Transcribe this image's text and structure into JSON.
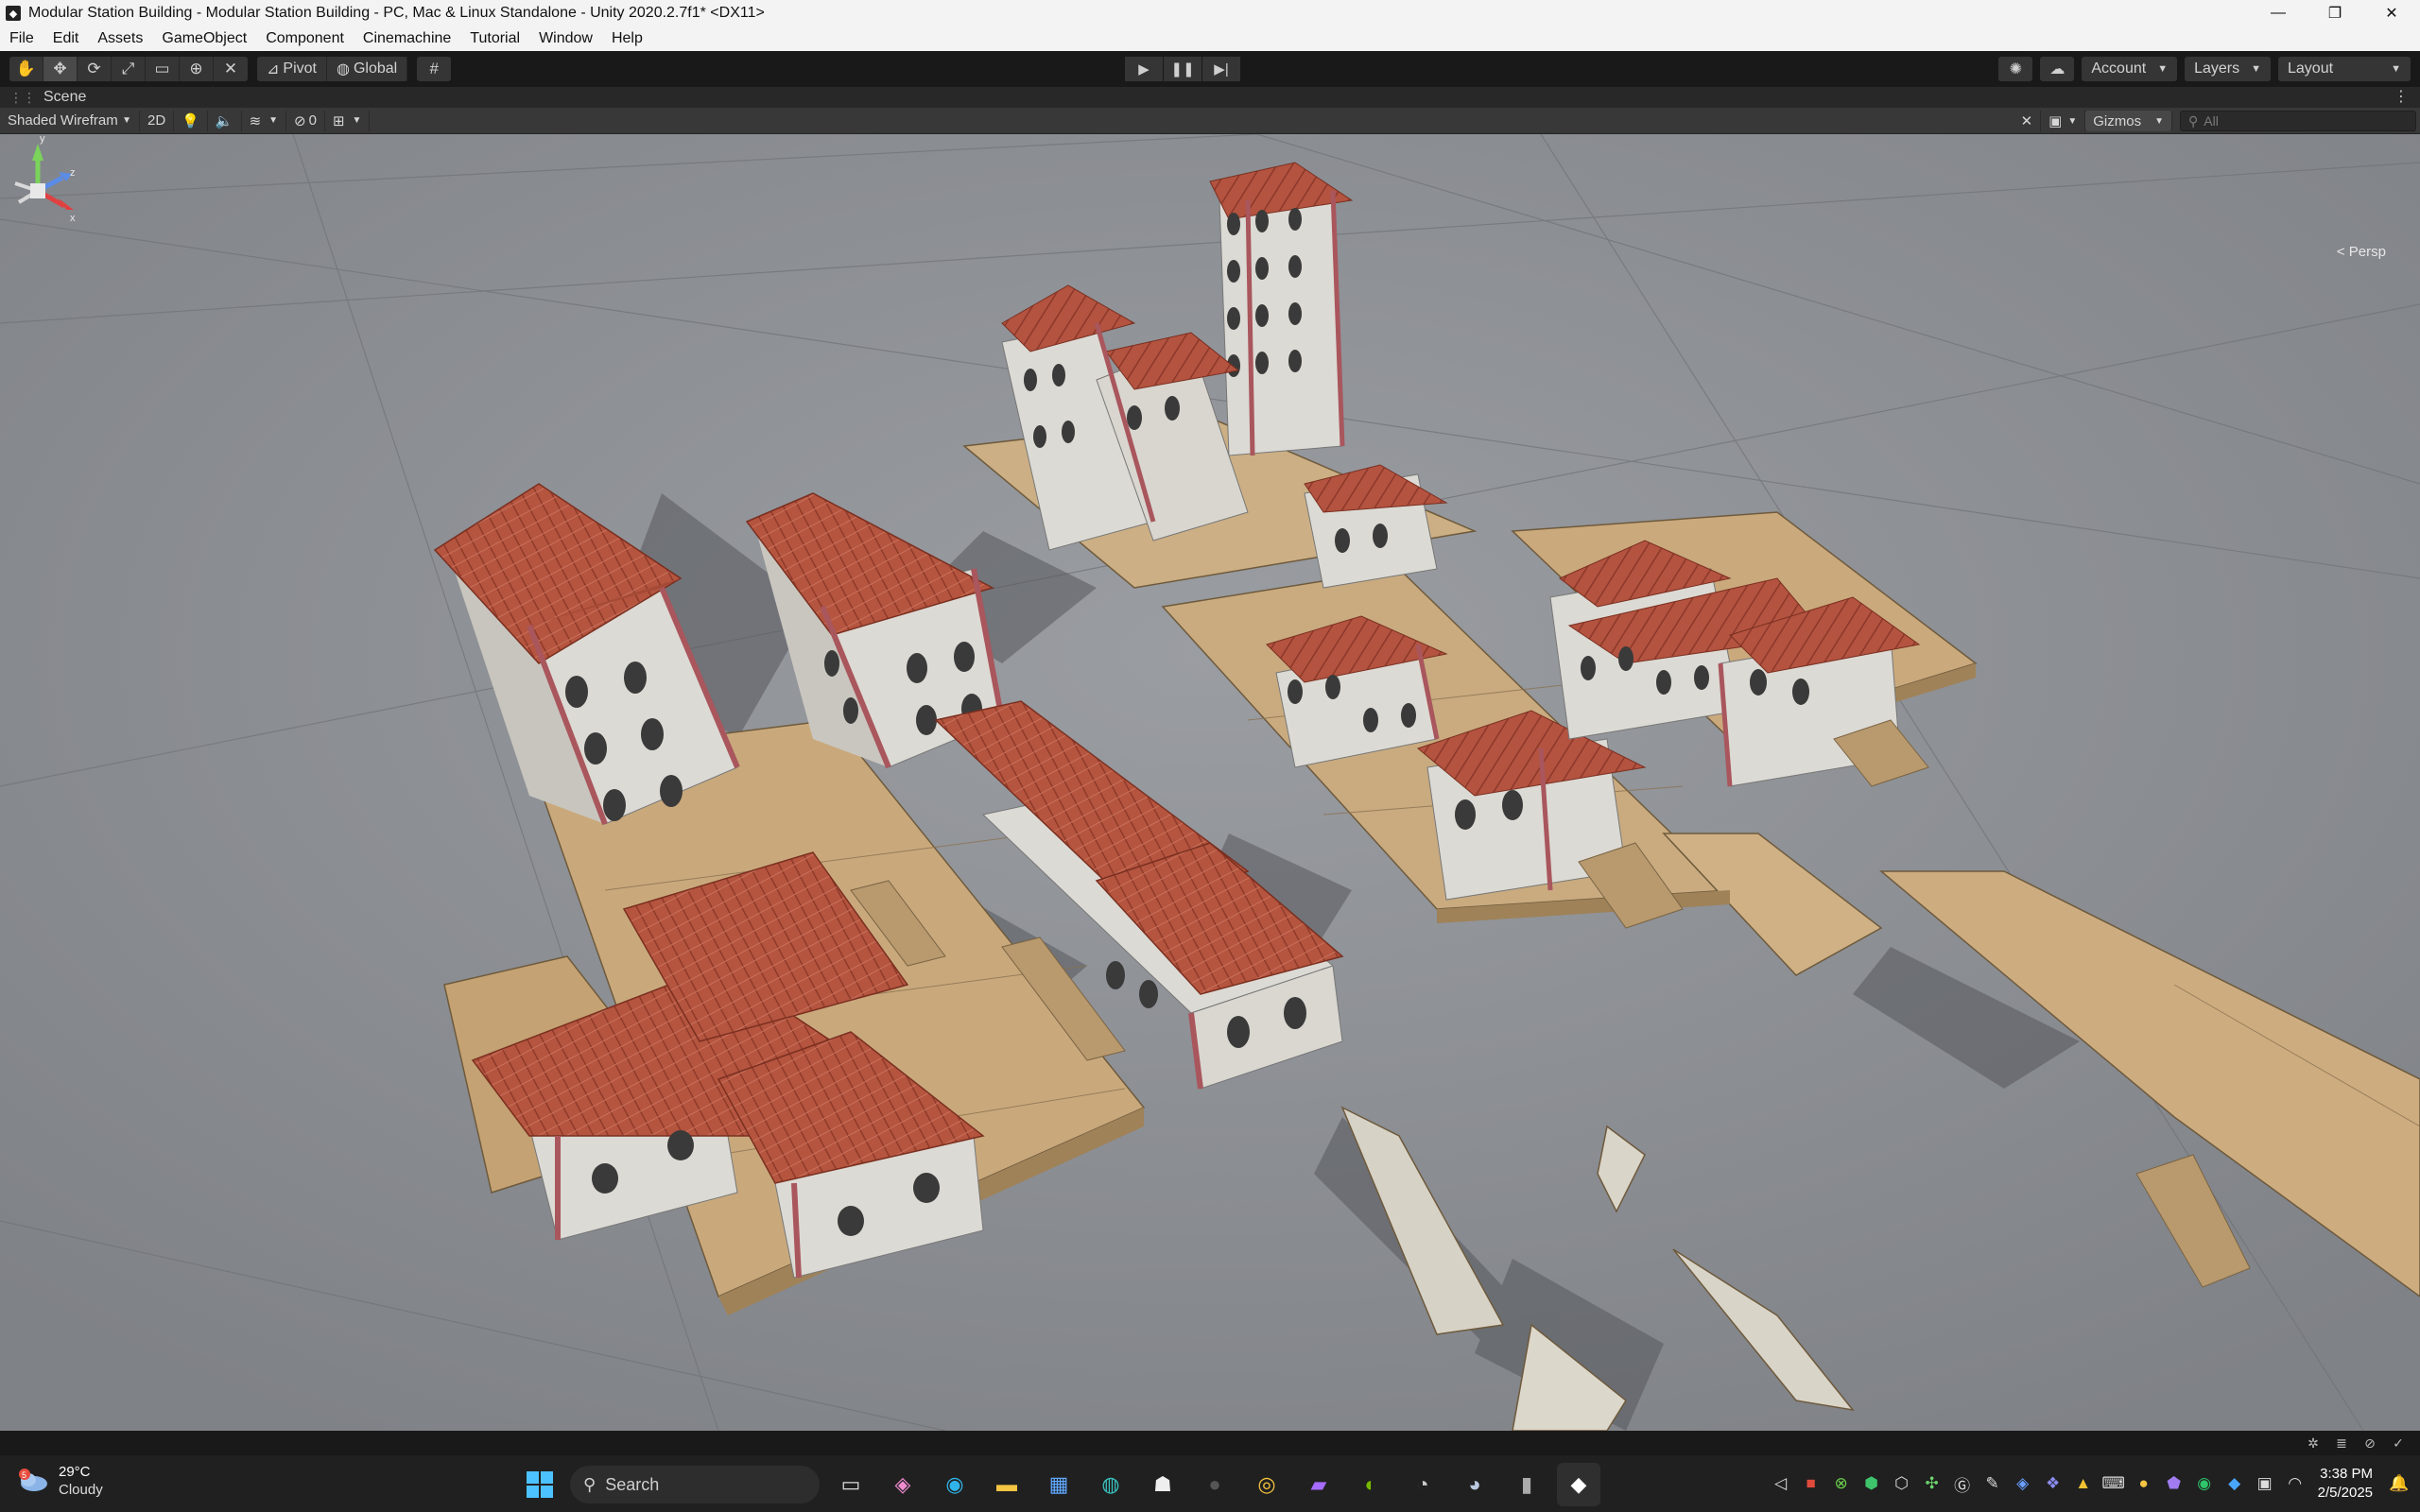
{
  "window": {
    "title": "Modular Station Building - Modular Station Building - PC, Mac & Linux Standalone - Unity 2020.2.7f1* <DX11>",
    "minimize": "—",
    "maximize": "❐",
    "close": "✕"
  },
  "menu": [
    "File",
    "Edit",
    "Assets",
    "GameObject",
    "Component",
    "Cinemachine",
    "Tutorial",
    "Window",
    "Help"
  ],
  "toolbar": {
    "pivot": "Pivot",
    "global": "Global",
    "account": "Account",
    "layers": "Layers",
    "layout": "Layout"
  },
  "scene": {
    "tab_label": "Scene",
    "shading_mode": "Shaded Wirefram",
    "mode_2d": "2D",
    "hidden_count": "0",
    "gizmos": "Gizmos",
    "search_placeholder": "All",
    "projection": "< Persp"
  },
  "taskbar": {
    "weather_temp": "29°C",
    "weather_condition": "Cloudy",
    "weather_badge": "5",
    "search_label": "Search",
    "time": "3:38 PM",
    "date": "2/5/2025"
  },
  "colors": {
    "roof": "#b5553f",
    "wall": "#dcdad4",
    "pillar": "#a9565d",
    "floor": "#c9a97c",
    "ground": "#8d9095"
  }
}
